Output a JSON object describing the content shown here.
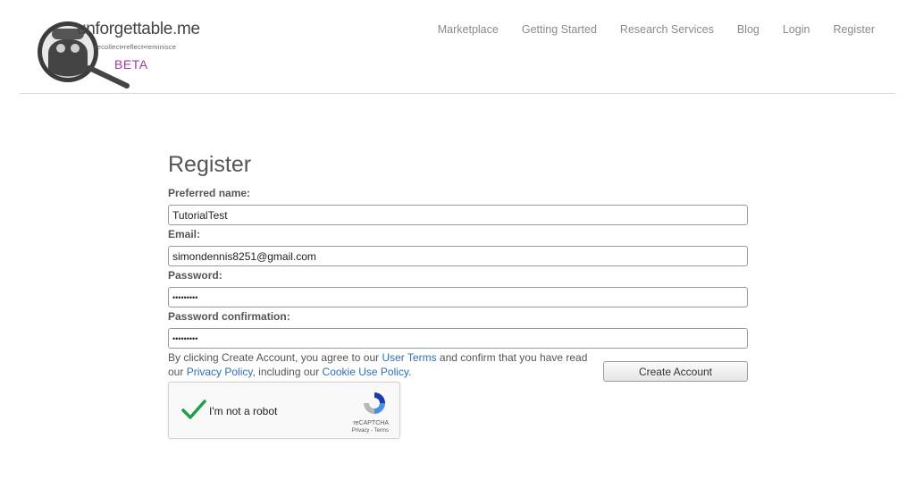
{
  "header": {
    "brand_prefix": "unforgettable",
    "brand_dot": ".",
    "brand_suffix": "me",
    "tagline": "recollect•reflect•reminisce",
    "beta": "BETA",
    "nav": [
      "Marketplace",
      "Getting Started",
      "Research Services",
      "Blog",
      "Login",
      "Register"
    ]
  },
  "form": {
    "title": "Register",
    "preferred_name_label": "Preferred name:",
    "preferred_name_value": "TutorialTest",
    "email_label": "Email:",
    "email_value": "simondennis8251@gmail.com",
    "password_label": "Password:",
    "password_value": "password1",
    "password_confirmation_label": "Password confirmation:",
    "password_confirmation_value": "password1",
    "terms_1": "By clicking Create Account, you agree to our ",
    "terms_link_user": "User Terms",
    "terms_2": " and confirm that you have read our ",
    "terms_link_privacy": "Privacy Policy",
    "terms_3": ", including our ",
    "terms_link_cookie": "Cookie Use Policy",
    "terms_4": ".",
    "create_button": "Create Account"
  },
  "captcha": {
    "label": "I'm not a robot",
    "brand": "reCAPTCHA",
    "links": "Privacy - Terms"
  },
  "colors": {
    "accent": "#a23a9e",
    "link": "#2f6fb3",
    "check": "#1e9e45"
  }
}
